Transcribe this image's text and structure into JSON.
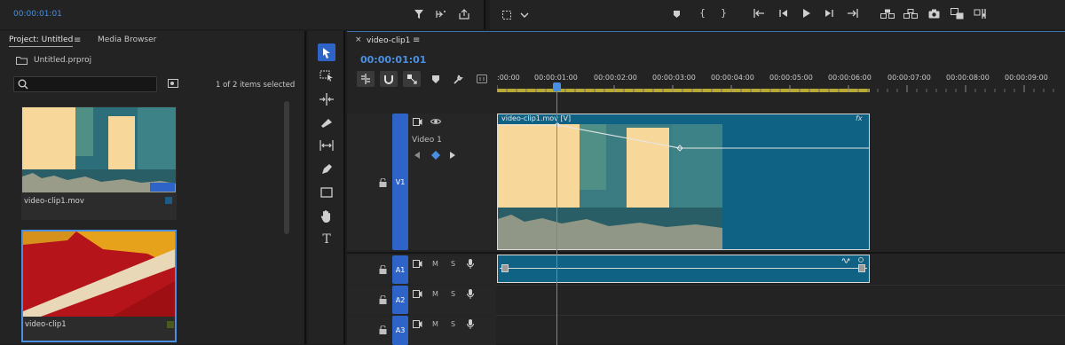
{
  "source_monitor": {
    "timecode": "00:00:01:01"
  },
  "program_controls": {
    "icons": [
      "marker-icon",
      "in-point-icon",
      "out-point-icon",
      "go-to-in-icon",
      "step-back-icon",
      "play-icon",
      "step-forward-icon",
      "go-to-out-icon",
      "lift-icon",
      "extract-icon",
      "export-frame-icon",
      "comparison-icon",
      "settings-icon"
    ]
  },
  "project_panel": {
    "tab_project": "Project: Untitled",
    "tab_media": "Media Browser",
    "project_file": "Untitled.prproj",
    "search_value": "",
    "selection_status": "1 of 2 items selected",
    "items": [
      {
        "name": "video-clip1.mov"
      },
      {
        "name": "video-clip1"
      }
    ]
  },
  "timeline": {
    "sequence_tab": "video-clip1",
    "playhead_timecode": "00:00:01:01",
    "ruler_ticks": [
      ":00:00",
      "00:00:01:00",
      "00:00:02:00",
      "00:00:03:00",
      "00:00:04:00",
      "00:00:05:00",
      "00:00:06:00",
      "00:00:07:00",
      "00:00:08:00",
      "00:00:09:00"
    ],
    "tracks": {
      "v1": {
        "label": "V1",
        "name": "Video 1"
      },
      "a1": {
        "label": "A1",
        "mute": "M",
        "solo": "S"
      },
      "a2": {
        "label": "A2",
        "mute": "M",
        "solo": "S"
      },
      "a3": {
        "label": "A3",
        "mute": "M",
        "solo": "S"
      }
    },
    "video_clip_label": "video-clip1.mov [V]",
    "fx_badge": "fx"
  },
  "colors": {
    "accent": "#2e64c8",
    "timecode": "#4a90e2",
    "clip": "#0f6283"
  }
}
